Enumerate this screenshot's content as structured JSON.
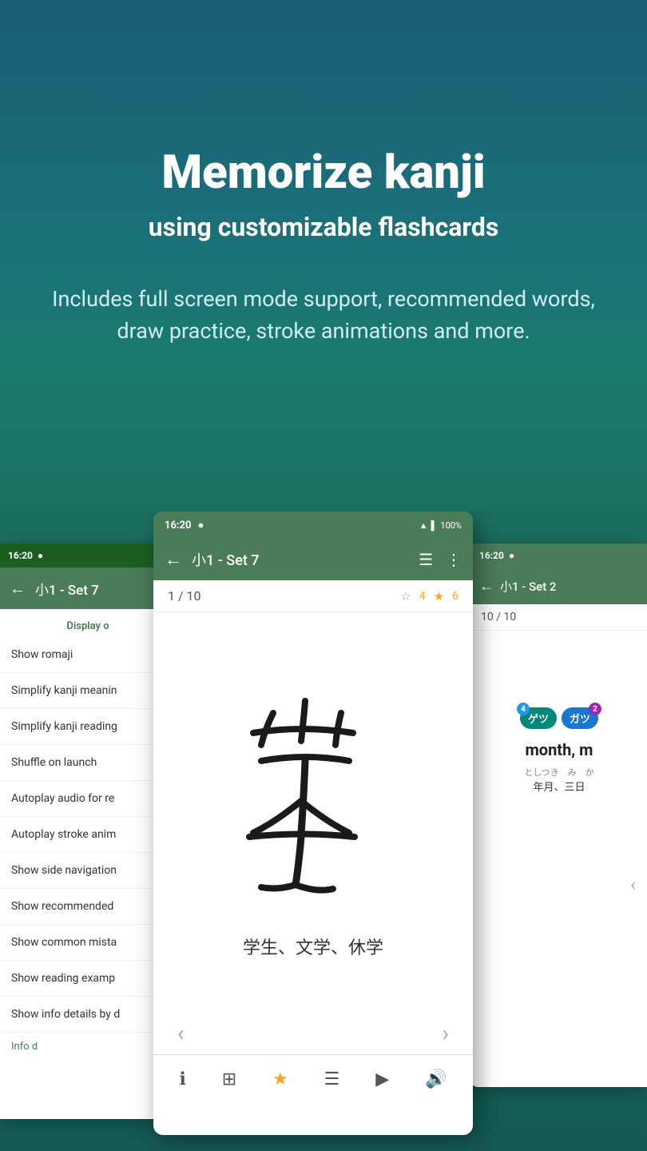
{
  "hero": {
    "title": "Memorize kanji",
    "subtitle": "using customizable flashcards",
    "description": "Includes full screen mode support, recommended words, draw practice, stroke animations and more."
  },
  "left_phone": {
    "statusbar": {
      "time": "16:20",
      "icon": "●"
    },
    "toolbar": {
      "back": "←",
      "title": "小1 - Set 7"
    },
    "section_title": "Display o",
    "menu_items": [
      "Show romaji",
      "Simplify kanji meanin",
      "Simplify kanji reading",
      "Shuffle on launch",
      "Autoplay audio for re",
      "Autoplay stroke anim",
      "Show side navigation",
      "Show recommended",
      "Show common mista",
      "Show reading examp",
      "Show info details by d"
    ],
    "info_label": "Info d"
  },
  "center_phone": {
    "statusbar": {
      "time": "16:20",
      "icon": "●",
      "signal": "▲",
      "battery": "100%"
    },
    "toolbar": {
      "back": "←",
      "title": "小1 - Set 7",
      "list_icon": "☰",
      "more_icon": "⋮"
    },
    "counter": {
      "current": "1",
      "total": "10",
      "star_empty": "☆",
      "star_count": "4",
      "star_filled": "★",
      "star_filled_count": "6"
    },
    "kanji": "学",
    "examples": "学生、文学、休学",
    "nav": {
      "prev": "‹",
      "next": "›"
    },
    "bottom_buttons": [
      {
        "icon": "ℹ",
        "name": "info"
      },
      {
        "icon": "⊞",
        "name": "grid"
      },
      {
        "icon": "★",
        "name": "star"
      },
      {
        "icon": "☰",
        "name": "list"
      },
      {
        "icon": "▶",
        "name": "play"
      },
      {
        "icon": "🔊",
        "name": "audio"
      }
    ]
  },
  "right_phone": {
    "statusbar": {
      "time": "16:20",
      "icon": "●"
    },
    "toolbar": {
      "back": "←",
      "title": "小1 - Set 2"
    },
    "counter": {
      "current": "10",
      "total": "10"
    },
    "badges": [
      {
        "text": "ゲツ",
        "sup": "4",
        "sup2": "",
        "color": "teal"
      },
      {
        "text": "ガツ",
        "sup": "",
        "sup2": "2",
        "color": "blue"
      }
    ],
    "meaning": "month, m",
    "reading_label": "としつき　み　か",
    "readings": "年月、三日",
    "nav": {
      "prev": "‹"
    }
  },
  "colors": {
    "hero_bg_top": "#1a5f75",
    "hero_bg_bottom": "#1a7060",
    "toolbar_green": "#4a7c59",
    "accent_teal": "#00897b",
    "accent_blue": "#1976d2",
    "star_gold": "#f5a623"
  }
}
